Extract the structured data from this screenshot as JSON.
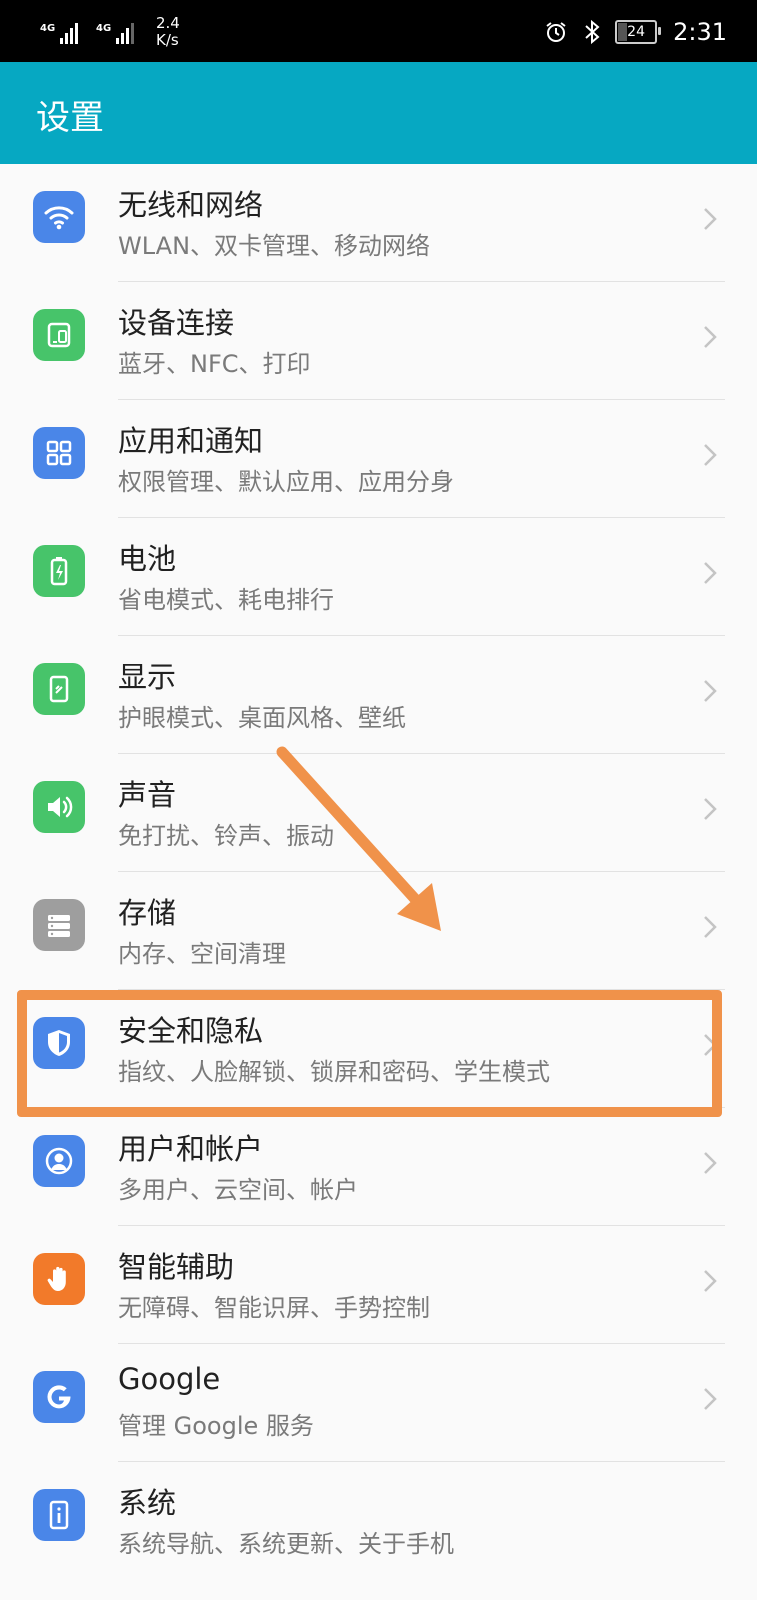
{
  "status_bar": {
    "signal1_tag": "4G",
    "signal2_tag": "4G",
    "speed_value": "2.4",
    "speed_unit": "K/s",
    "battery_level": "24",
    "time": "2:31"
  },
  "app_bar": {
    "title": "设置"
  },
  "settings": [
    {
      "title": "无线和网络",
      "subtitle": "WLAN、双卡管理、移动网络",
      "icon": "wifi-icon",
      "color": "#4a86e8"
    },
    {
      "title": "设备连接",
      "subtitle": "蓝牙、NFC、打印",
      "icon": "device-connect-icon",
      "color": "#47c46a"
    },
    {
      "title": "应用和通知",
      "subtitle": "权限管理、默认应用、应用分身",
      "icon": "apps-grid-icon",
      "color": "#4a86e8"
    },
    {
      "title": "电池",
      "subtitle": "省电模式、耗电排行",
      "icon": "battery-icon",
      "color": "#47c46a"
    },
    {
      "title": "显示",
      "subtitle": "护眼模式、桌面风格、壁纸",
      "icon": "display-icon",
      "color": "#47c46a"
    },
    {
      "title": "声音",
      "subtitle": "免打扰、铃声、振动",
      "icon": "speaker-icon",
      "color": "#47c46a"
    },
    {
      "title": "存储",
      "subtitle": "内存、空间清理",
      "icon": "storage-icon",
      "color": "#9e9e9e"
    },
    {
      "title": "安全和隐私",
      "subtitle": "指纹、人脸解锁、锁屏和密码、学生模式",
      "icon": "shield-icon",
      "color": "#4a86e8"
    },
    {
      "title": "用户和帐户",
      "subtitle": "多用户、云空间、帐户",
      "icon": "user-icon",
      "color": "#4a86e8"
    },
    {
      "title": "智能辅助",
      "subtitle": "无障碍、智能识屏、手势控制",
      "icon": "hand-icon",
      "color": "#f27a2a"
    },
    {
      "title": "Google",
      "subtitle": "管理 Google 服务",
      "icon": "google-icon",
      "color": "#4a86e8"
    },
    {
      "title": "系统",
      "subtitle": "系统导航、系统更新、关于手机",
      "icon": "system-info-icon",
      "color": "#4a86e8"
    }
  ],
  "annotation": {
    "highlight_color": "#f0924a"
  }
}
